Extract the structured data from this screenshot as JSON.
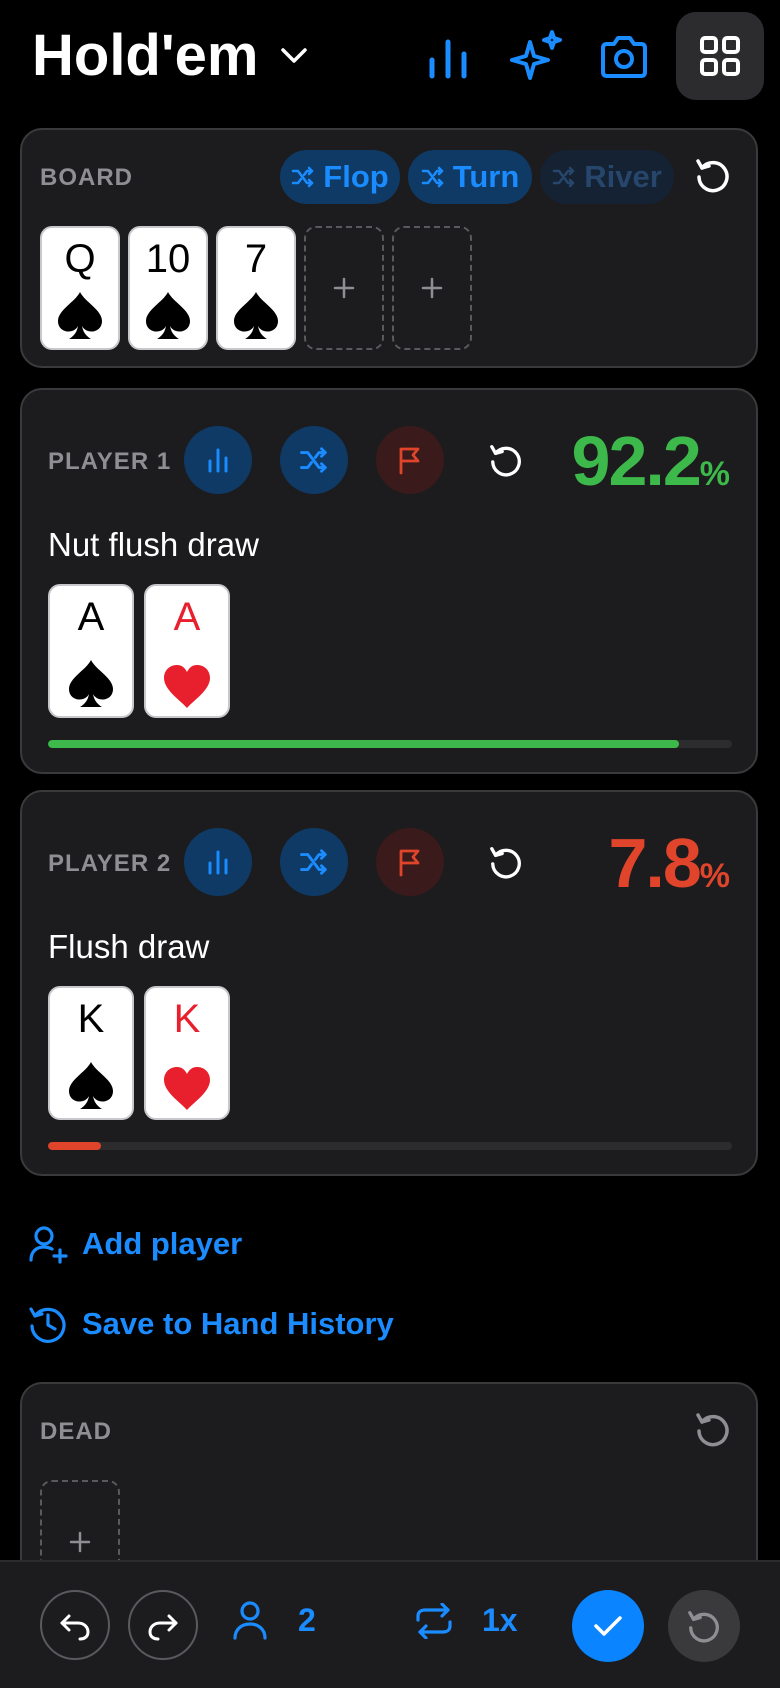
{
  "header": {
    "title": "Hold'em"
  },
  "board": {
    "label": "BOARD",
    "chips": [
      "Flop",
      "Turn",
      "River"
    ],
    "cards": [
      {
        "rank": "Q",
        "suit": "spade"
      },
      {
        "rank": "10",
        "suit": "spade"
      },
      {
        "rank": "7",
        "suit": "spade"
      }
    ],
    "empty_slots": 2
  },
  "players": [
    {
      "label": "PLAYER 1",
      "equity": "92.2",
      "equity_unit": "%",
      "equity_fraction": 0.922,
      "hand": "Nut flush draw",
      "color": "#3db84a",
      "cards": [
        {
          "rank": "A",
          "suit": "spade"
        },
        {
          "rank": "A",
          "suit": "heart"
        }
      ]
    },
    {
      "label": "PLAYER 2",
      "equity": "7.8",
      "equity_unit": "%",
      "equity_fraction": 0.078,
      "hand": "Flush draw",
      "color": "#e0452c",
      "cards": [
        {
          "rank": "K",
          "suit": "spade"
        },
        {
          "rank": "K",
          "suit": "heart"
        }
      ]
    }
  ],
  "actions": {
    "add_player": "Add player",
    "save_history": "Save to Hand History"
  },
  "dead": {
    "label": "DEAD"
  },
  "bottom": {
    "player_count": "2",
    "repeat": "1x"
  },
  "colors": {
    "accent": "#1a8cff",
    "panel": "#1c1c1e",
    "win": "#3db84a",
    "lose": "#e0452c"
  }
}
